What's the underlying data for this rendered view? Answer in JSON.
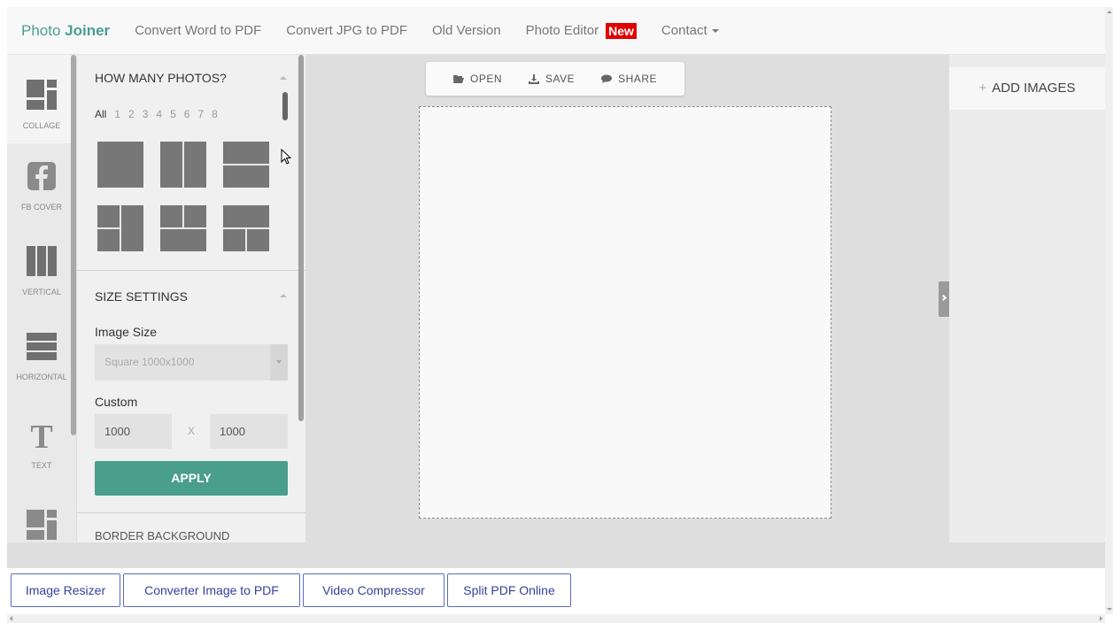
{
  "nav": {
    "brand_photo": "Photo ",
    "brand_joiner": "Joiner",
    "links": [
      "Convert Word to PDF",
      "Convert JPG to PDF",
      "Old Version",
      "Photo Editor"
    ],
    "new_badge": "New",
    "contact": "Contact"
  },
  "sidebar": {
    "items": [
      {
        "label": "COLLAGE",
        "icon": "collage-icon"
      },
      {
        "label": "FB COVER",
        "icon": "facebook-icon"
      },
      {
        "label": "VERTICAL",
        "icon": "vertical-icon"
      },
      {
        "label": "HORIZONTAL",
        "icon": "horizontal-icon"
      },
      {
        "label": "TEXT",
        "icon": "text-icon"
      },
      {
        "label": "",
        "icon": "collage-icon"
      }
    ]
  },
  "panel": {
    "photos_title": "HOW MANY PHOTOS?",
    "counts": [
      "All",
      "1",
      "2",
      "3",
      "4",
      "5",
      "6",
      "7",
      "8"
    ],
    "size_title": "SIZE SETTINGS",
    "image_size_label": "Image Size",
    "image_size_value": "Square 1000x1000",
    "custom_label": "Custom",
    "width_value": "1000",
    "x_sep": "X",
    "height_value": "1000",
    "apply_label": "APPLY",
    "border_title": "BORDER BACKGROUND"
  },
  "toolbar": {
    "open": "OPEN",
    "save": "SAVE",
    "share": "SHARE"
  },
  "right": {
    "add_images": "ADD IMAGES"
  },
  "footer": {
    "links": [
      "Image Resizer",
      "Converter Image to PDF",
      "Video Compressor",
      "Split PDF Online"
    ]
  },
  "colors": {
    "brand": "#4a9e94",
    "apply": "#4a9e8c",
    "new_badge": "#e00000",
    "footer_link": "#35429a"
  }
}
